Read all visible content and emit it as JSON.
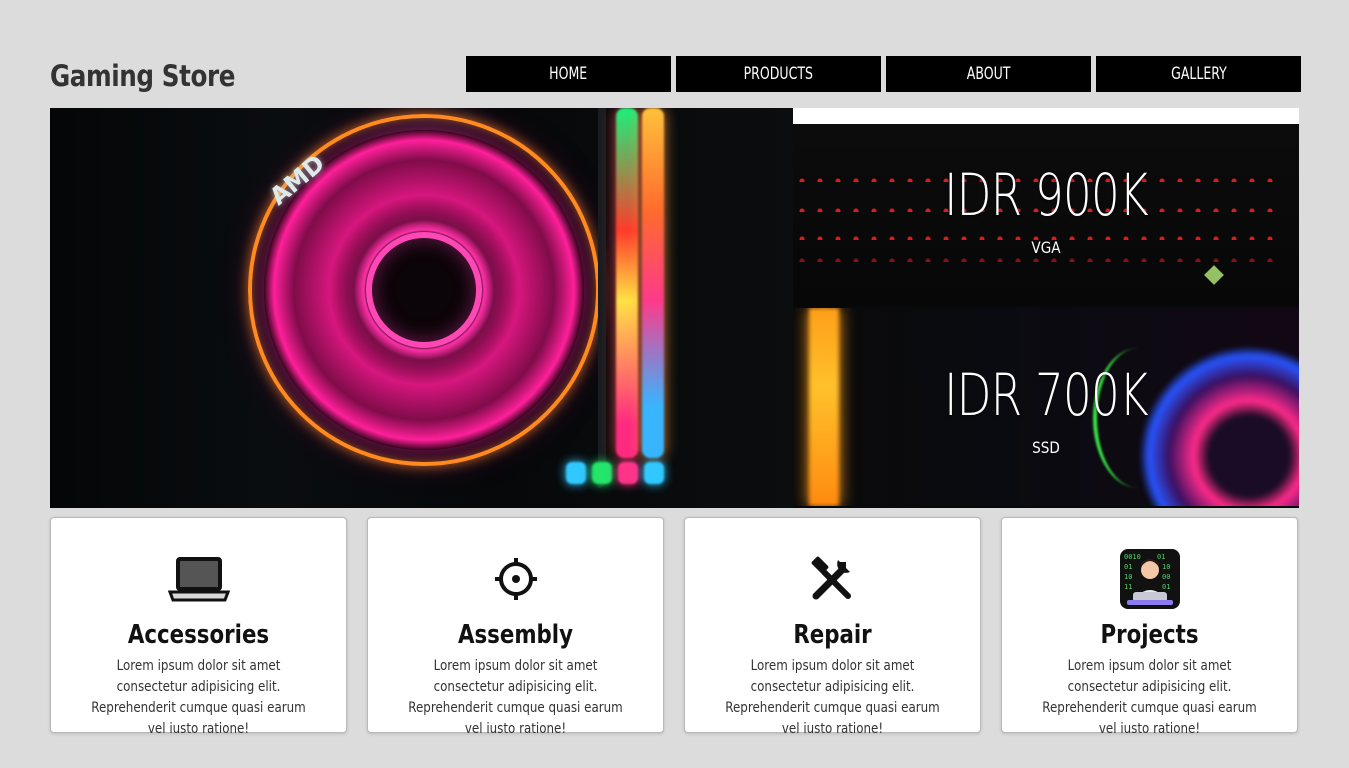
{
  "header": {
    "logo": "Gaming Store",
    "nav": [
      "HOME",
      "PRODUCTS",
      "ABOUT",
      "GALLERY"
    ]
  },
  "hero": {
    "main_image": {
      "brand_text": "AMD"
    },
    "cards": [
      {
        "price": "IDR 900K",
        "label": "VGA"
      },
      {
        "price": "IDR 700K",
        "label": "SSD"
      }
    ]
  },
  "features": [
    {
      "icon": "laptop-icon",
      "title": "Accessories",
      "text": "Lorem ipsum dolor sit amet consectetur adipisicing elit. Reprehenderit cumque quasi earum vel iusto ratione!"
    },
    {
      "icon": "crosshair-icon",
      "title": "Assembly",
      "text": "Lorem ipsum dolor sit amet consectetur adipisicing elit. Reprehenderit cumque quasi earum vel iusto ratione!"
    },
    {
      "icon": "tools-icon",
      "title": "Repair",
      "text": "Lorem ipsum dolor sit amet consectetur adipisicing elit. Reprehenderit cumque quasi earum vel iusto ratione!"
    },
    {
      "icon": "technologist-icon",
      "title": "Projects",
      "text": "Lorem ipsum dolor sit amet consectetur adipisicing elit. Reprehenderit cumque quasi earum vel iusto ratione!"
    }
  ],
  "colors": {
    "background": "#dcdcdc",
    "nav_bg": "#000000",
    "card_bg": "#ffffff"
  }
}
